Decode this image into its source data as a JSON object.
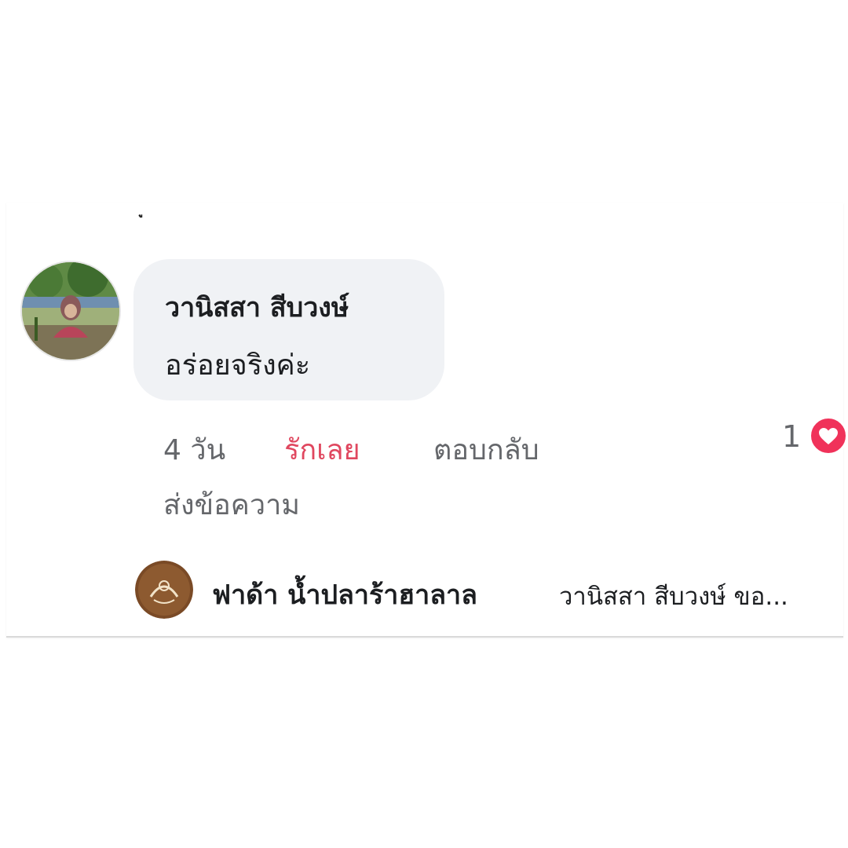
{
  "comment": {
    "author": "วานิสสา สีบวงษ์",
    "text": "อร่อยจริงค่ะ",
    "time": "4 วัน",
    "love_label": "รักเลย",
    "reply_label": "ตอบกลับ",
    "send_message_label": "ส่งข้อความ",
    "reaction_count": "1",
    "reaction_icon": "heart-icon"
  },
  "reply": {
    "author": "ฟาด้า น้ำปลาร้าฮาลาล",
    "preview": "วานิสสา สีบวงษ์ ขอ..."
  },
  "colors": {
    "bubble_bg": "#f0f2f5",
    "love_accent": "#e0475f",
    "heart_badge": "#f0325a",
    "secondary_text": "#65676b"
  }
}
